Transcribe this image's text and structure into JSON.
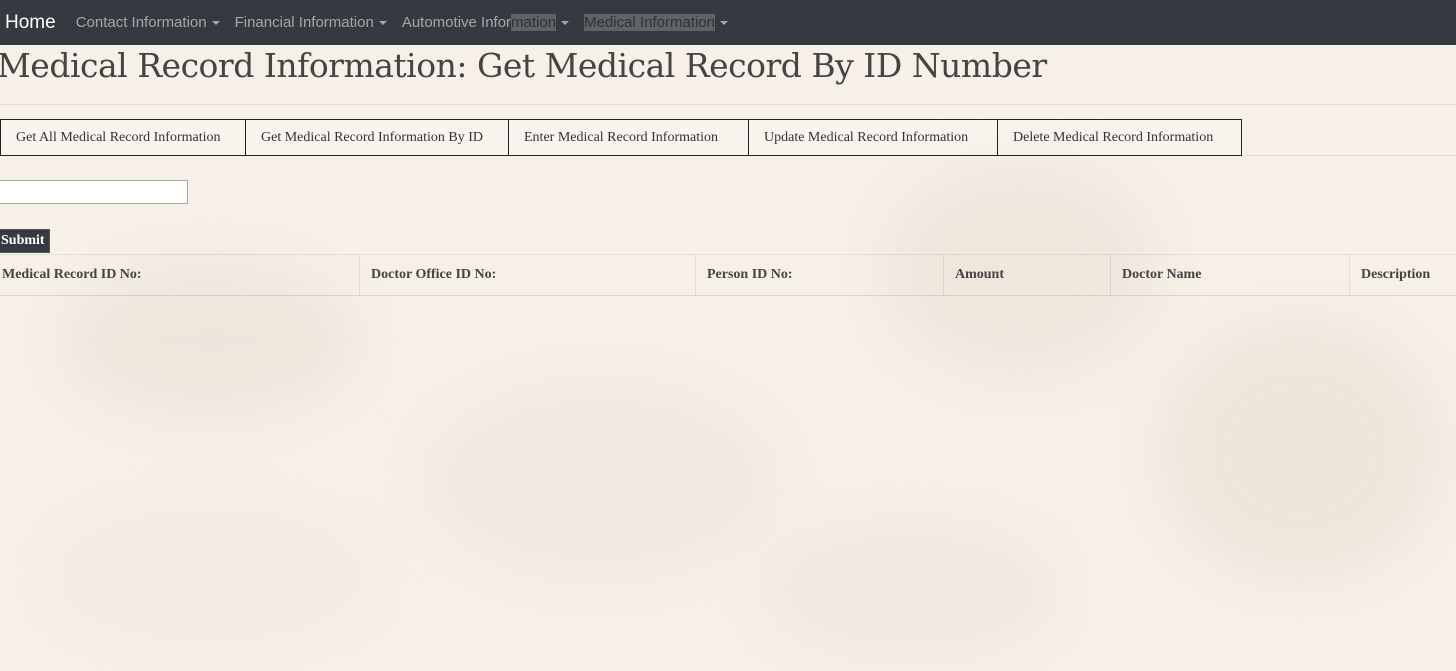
{
  "navbar": {
    "brand": "Home",
    "items": [
      {
        "label": "Contact Information"
      },
      {
        "label": "Financial Information"
      },
      {
        "label_part1": "Automotive Infor",
        "label_part2": "mation"
      },
      {
        "label": "Medical Information"
      }
    ]
  },
  "page": {
    "title": "Medical Record Information: Get Medical Record By ID Number"
  },
  "tabs": [
    {
      "label": "Get All Medical Record Information"
    },
    {
      "label": "Get Medical Record Information By ID"
    },
    {
      "label": "Enter Medical Record Information"
    },
    {
      "label": "Update Medical Record Information"
    },
    {
      "label": "Delete Medical Record Information"
    }
  ],
  "form": {
    "id_value": "",
    "submit_label": "Submit"
  },
  "table": {
    "columns": [
      "Medical Record ID No:",
      "Doctor Office ID No:",
      "Person ID No:",
      "Amount",
      "Doctor Name",
      "Description"
    ]
  }
}
